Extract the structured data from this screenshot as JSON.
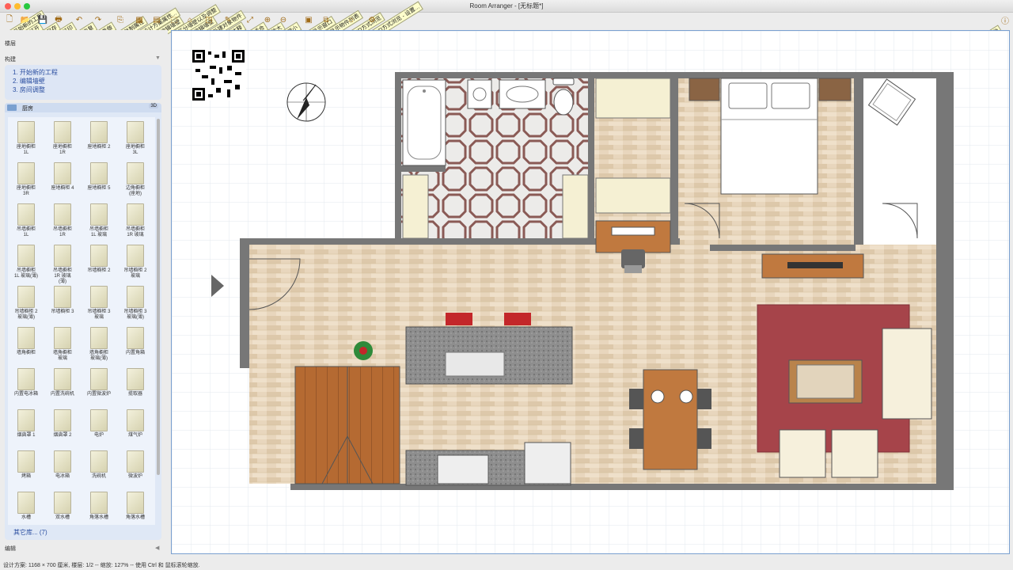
{
  "window": {
    "title": "Room Arranger - [无标题*]"
  },
  "colors": {
    "close": "#fe5f57",
    "minimize": "#febc2e",
    "zoom": "#28c840",
    "link": "#2a4ea0",
    "wall": "#777777",
    "floor": "#e6d3b8"
  },
  "toolbar": {
    "buttons": [
      {
        "icon": "new-project-icon",
        "glyph": "🗋",
        "tip": "开始新的工程"
      },
      {
        "icon": "open-icon",
        "glyph": "📂",
        "tip": "打开"
      },
      {
        "icon": "save-icon",
        "glyph": "💾",
        "tip": "保存"
      },
      {
        "icon": "print-icon",
        "glyph": "🖶",
        "tip": "打印"
      },
      {
        "icon": "undo-icon",
        "glyph": "↶",
        "tip": "恢复"
      },
      {
        "icon": "redo-icon",
        "glyph": "↷",
        "tip": "重做"
      },
      {
        "icon": "copy-icon",
        "glyph": "⎘",
        "tip": "复制属性"
      },
      {
        "icon": "project-settings-icon",
        "glyph": "▦",
        "tip": "设计方案属性..."
      },
      {
        "icon": "edit-wall-icon",
        "glyph": "▤",
        "tip": "编辑墙壁"
      },
      {
        "icon": "room-icon",
        "glyph": "⬚",
        "tip": "区分墙壁以及调整"
      },
      {
        "icon": "door-icon",
        "glyph": "⌂",
        "tip": "编辑墙壁"
      },
      {
        "icon": "object-icon",
        "glyph": "◳",
        "tip": "新建对象物件"
      },
      {
        "icon": "note-icon",
        "glyph": "✎",
        "tip": "注释"
      },
      {
        "icon": "zoom-fit-icon",
        "glyph": "⤢",
        "tip": "适合"
      },
      {
        "icon": "zoom-in-icon",
        "glyph": "⊕",
        "tip": "放大"
      },
      {
        "icon": "zoom-out-icon",
        "glyph": "⊖",
        "tip": "缩小"
      },
      {
        "icon": "view-window-icon",
        "glyph": "▣",
        "tip": "显示窗口"
      },
      {
        "icon": "multi-view-icon",
        "glyph": "⧉",
        "tip": "显示物件列表"
      },
      {
        "icon": "3d-view-icon",
        "glyph": "⌂",
        "tip": "3D方式浏览"
      },
      {
        "icon": "3d-settings-icon",
        "glyph": "⚙",
        "tip": "3D方式浏览 - 设置..."
      }
    ],
    "help_tip": "帮助"
  },
  "sidebar": {
    "floor_label": "楼层",
    "build_label": "构建",
    "steps": [
      "1. 开始新的工程",
      "2. 编辑墙壁",
      "3. 房间调整"
    ],
    "library_title": "厨房",
    "library_badge": "3D",
    "items": [
      {
        "label": "座地橱柜\n1L"
      },
      {
        "label": "座地橱柜\n1R"
      },
      {
        "label": "座地橱柜 2"
      },
      {
        "label": "座地橱柜\n3L"
      },
      {
        "label": "座地橱柜\n3R"
      },
      {
        "label": "座地橱柜 4"
      },
      {
        "label": "座地橱柜 5"
      },
      {
        "label": "边角橱柜\n(座地)"
      },
      {
        "label": "吊墙橱柜\n1L"
      },
      {
        "label": "吊墙橱柜\n1R"
      },
      {
        "label": "吊墙橱柜\n1L 玻璃"
      },
      {
        "label": "吊墙橱柜\n1R 玻璃"
      },
      {
        "label": "吊墙橱柜\n1L 玻璃(薄)"
      },
      {
        "label": "吊墙橱柜\n1R 玻璃\n(薄)"
      },
      {
        "label": "吊墙橱柜 2"
      },
      {
        "label": "吊墙橱柜 2\n玻璃"
      },
      {
        "label": "吊墙橱柜 2\n玻璃(薄)"
      },
      {
        "label": "吊墙橱柜 3"
      },
      {
        "label": "吊墙橱柜 3\n玻璃"
      },
      {
        "label": "吊墙橱柜 3\n玻璃(薄)"
      },
      {
        "label": "墙角橱柜"
      },
      {
        "label": "墙角橱柜\n玻璃"
      },
      {
        "label": "墙角橱柜\n玻璃(薄)"
      },
      {
        "label": "内置角箱"
      },
      {
        "label": "内置电冰箱"
      },
      {
        "label": "内置洗碗机"
      },
      {
        "label": "内置微波炉"
      },
      {
        "label": "揽取器"
      },
      {
        "label": "烟囱罩 1"
      },
      {
        "label": "烟囱罩 2"
      },
      {
        "label": "电炉"
      },
      {
        "label": "煤气炉"
      },
      {
        "label": "烤箱"
      },
      {
        "label": "电冰箱"
      },
      {
        "label": "洗碗机"
      },
      {
        "label": "微波炉"
      },
      {
        "label": "水槽"
      },
      {
        "label": "双水槽"
      },
      {
        "label": "角落水槽"
      },
      {
        "label": "角落水槽"
      },
      {
        "label": ""
      },
      {
        "label": ""
      },
      {
        "label": ""
      },
      {
        "label": ""
      }
    ],
    "more_libraries": "其它库... (7)",
    "edit_label": "编辑"
  },
  "status": {
    "text": "设计方案: 1168 × 700 厘米, 楼层: 1/2 -- 缩放: 127% -- 使用 Ctrl 和 鼠标滚轮缩放."
  }
}
